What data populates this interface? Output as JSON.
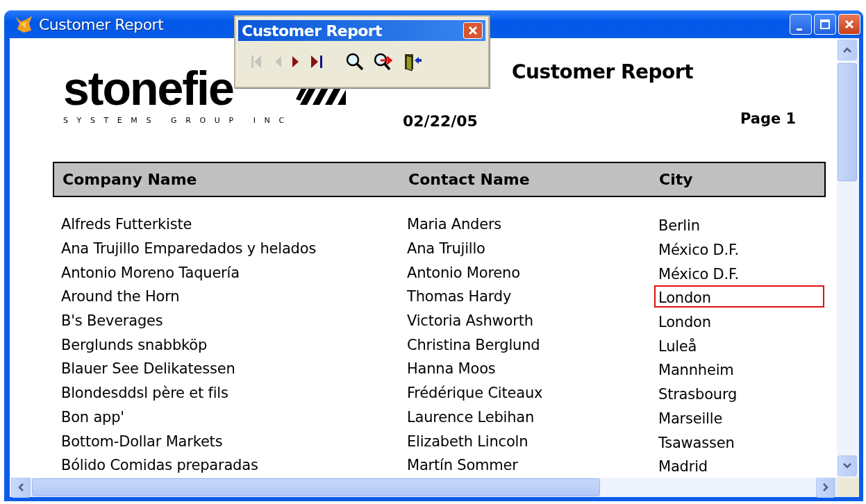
{
  "window": {
    "title": "Customer Report"
  },
  "toolbar": {
    "title": "Customer Report",
    "buttons": [
      {
        "kind": "first",
        "disabled": true
      },
      {
        "kind": "previous",
        "disabled": true
      },
      {
        "kind": "next",
        "disabled": false
      },
      {
        "kind": "last",
        "disabled": false
      },
      {
        "kind": "zoom",
        "disabled": false
      },
      {
        "kind": "find",
        "disabled": false
      },
      {
        "kind": "exit",
        "disabled": false
      }
    ]
  },
  "report": {
    "logo": {
      "wordmark": "stonefie",
      "tagline": "SYSTEMS GROUP INC"
    },
    "title": "Customer Report",
    "date": "02/22/05",
    "page": "Page 1",
    "columns": [
      "Company Name",
      "Contact Name",
      "City"
    ],
    "rows": [
      {
        "company": "Alfreds Futterkiste",
        "contact": "Maria Anders",
        "city": "Berlin",
        "selected": false
      },
      {
        "company": "Ana Trujillo Emparedados y helados",
        "contact": "Ana Trujillo",
        "city": "México D.F.",
        "selected": false
      },
      {
        "company": "Antonio Moreno Taquería",
        "contact": "Antonio Moreno",
        "city": "México D.F.",
        "selected": false
      },
      {
        "company": "Around the Horn",
        "contact": "Thomas Hardy",
        "city": "London",
        "selected": true
      },
      {
        "company": "B's Beverages",
        "contact": "Victoria Ashworth",
        "city": "London",
        "selected": false
      },
      {
        "company": "Berglunds snabbköp",
        "contact": "Christina Berglund",
        "city": "Luleå",
        "selected": false
      },
      {
        "company": "Blauer See Delikatessen",
        "contact": "Hanna Moos",
        "city": "Mannheim",
        "selected": false
      },
      {
        "company": "Blondesddsl père et fils",
        "contact": "Frédérique Citeaux",
        "city": "Strasbourg",
        "selected": false
      },
      {
        "company": "Bon app'",
        "contact": "Laurence Lebihan",
        "city": "Marseille",
        "selected": false
      },
      {
        "company": "Bottom-Dollar Markets",
        "contact": "Elizabeth Lincoln",
        "city": "Tsawassen",
        "selected": false
      },
      {
        "company": "Bólido Comidas preparadas",
        "contact": "Martín Sommer",
        "city": "Madrid",
        "selected": false
      }
    ]
  }
}
